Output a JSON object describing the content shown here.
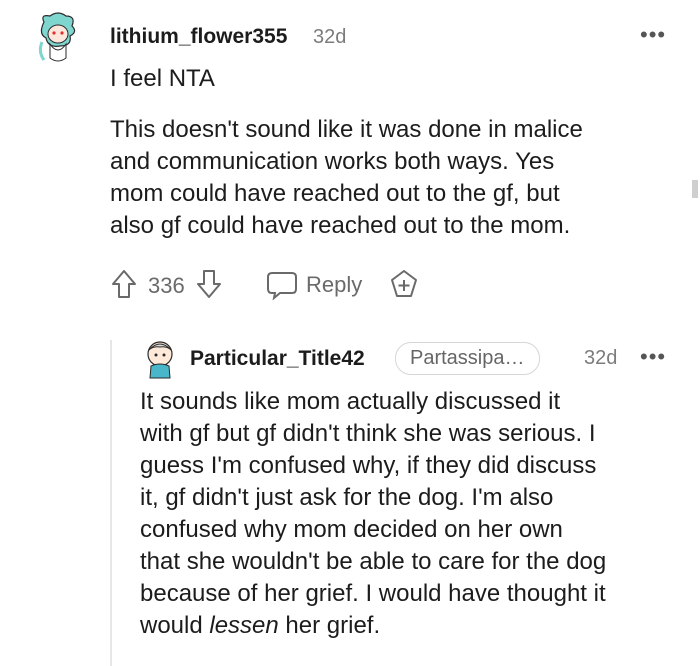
{
  "comment": {
    "username": "lithium_flower355",
    "age": "32d",
    "title": "I feel NTA",
    "body_lines": [
      "This doesn't sound like it was done in malice",
      "and communication works both ways. Yes",
      "mom could have reached out to the gf, but",
      "also gf could have reached out to the mom."
    ],
    "score": "336",
    "reply_label": "Reply",
    "menu_icon": "more-dots-icon"
  },
  "reply": {
    "username": "Particular_Title42",
    "flair": "Partassipa…",
    "age": "32d",
    "body_lines": [
      "It sounds like mom actually discussed it",
      "with gf but gf didn't think she was serious. I",
      "guess I'm confused why, if they did discuss",
      "it, gf didn't just ask for the dog. I'm also",
      "confused why mom decided on her own",
      "that she wouldn't be able to care for the dog",
      "because of her grief. I would have thought it"
    ],
    "last_line_pre": "would ",
    "last_line_em": "lessen",
    "last_line_post": " her grief."
  },
  "colors": {
    "text": "#1c1c1c",
    "muted": "#7c7c7c",
    "icon": "#6a6a6a"
  }
}
